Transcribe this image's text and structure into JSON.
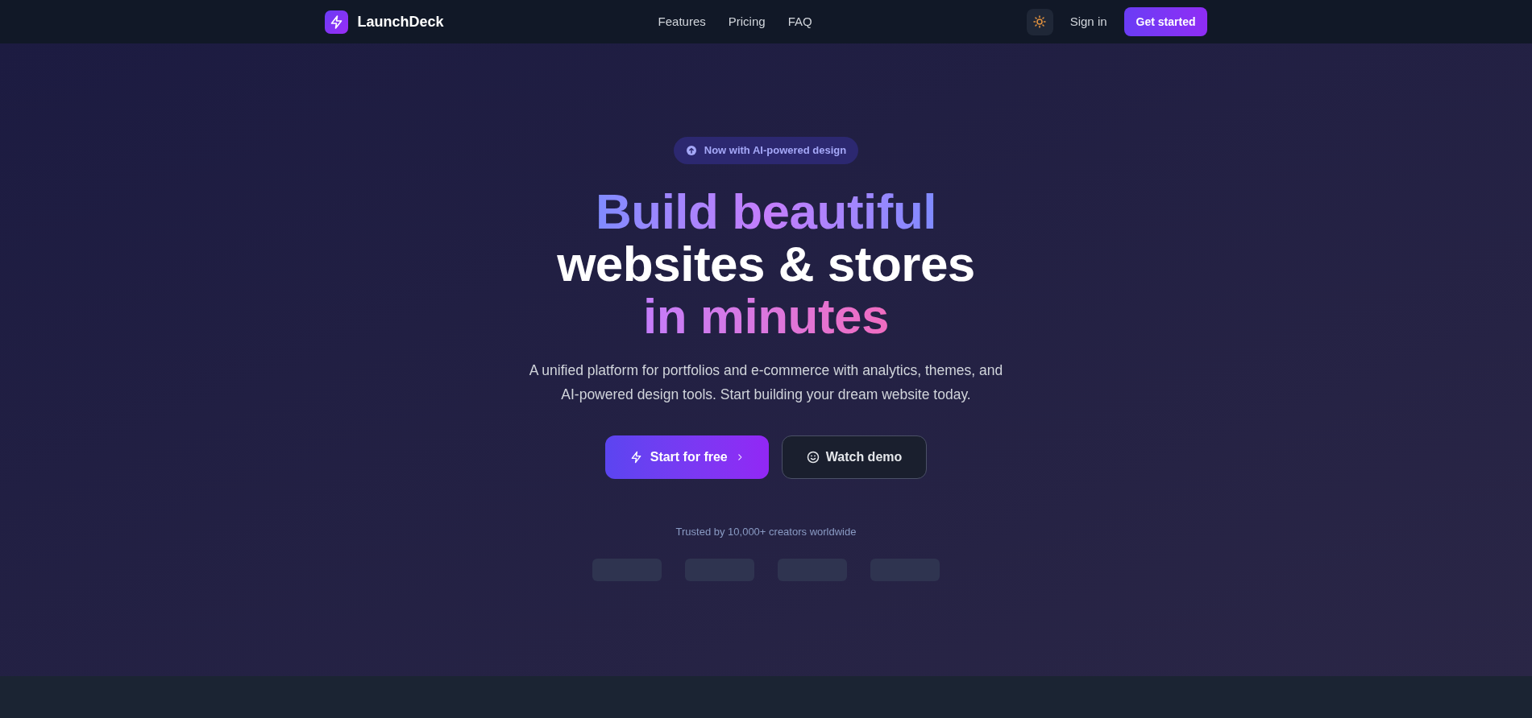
{
  "nav": {
    "brand": "LaunchDeck",
    "links": [
      "Features",
      "Pricing",
      "FAQ"
    ],
    "sign_in": "Sign in",
    "cta": "Get started"
  },
  "hero": {
    "badge": "Now with AI-powered design",
    "heading": [
      {
        "text": "Build beautiful",
        "kind": "cool"
      },
      {
        "text": "websites & stores",
        "kind": "plain"
      },
      {
        "text": "in minutes",
        "kind": "warm"
      }
    ],
    "description": "A unified platform for portfolios and e-commerce with analytics, themes, and AI-powered design tools. Start building your dream website today.",
    "buttons": [
      {
        "label": "Start for free",
        "kind": "primary"
      },
      {
        "label": "Watch demo",
        "kind": "secondary"
      }
    ],
    "trusted": {
      "text": "Trusted by 10,000+ creators worldwide",
      "logos": [
        {
          "kind": "placeholder"
        },
        {
          "kind": "placeholder"
        },
        {
          "kind": "placeholder"
        },
        {
          "kind": "placeholder"
        }
      ]
    }
  }
}
